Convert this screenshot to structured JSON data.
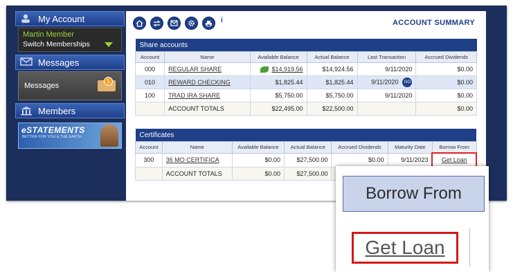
{
  "sidebar": {
    "my_account": "My Account",
    "member_name": "Martin Member",
    "switch_memberships": "Switch Memberships",
    "messages_header": "Messages",
    "messages_label": "Messages",
    "messages_badge": "1",
    "members_header": "Members",
    "estatements_title": "eSTATEMENTS",
    "estatements_tagline": "BETTER FOR YOU & THE EARTH"
  },
  "toolbar": {
    "icons": [
      "home-icon",
      "transfer-icon",
      "mail-icon",
      "settings-icon",
      "print-icon"
    ],
    "info": "i",
    "title": "ACCOUNT SUMMARY"
  },
  "shares": {
    "section_title": "Share accounts",
    "headers": [
      "Account",
      "Name",
      "Available Balance",
      "Actual Balance",
      "Last Transaction",
      "Accrued Dividends"
    ],
    "rows": [
      {
        "account": "000",
        "name": "REGULAR SHARE",
        "available": "$14,919.56",
        "actual": "$14,924.56",
        "last": "9/11/2020",
        "dividends": "$0.00"
      },
      {
        "account": "010",
        "name": "REWARD CHECKING",
        "available": "$1,825.44",
        "actual": "$1,825.44",
        "last": "9/11/2020",
        "dividends": "$0.00"
      },
      {
        "account": "100",
        "name": "TRAD IRA SHARE",
        "available": "$5,750.00",
        "actual": "$5,750.00",
        "last": "9/11/2020",
        "dividends": "$0.00"
      }
    ],
    "totals": {
      "label": "ACCOUNT TOTALS",
      "available": "$22,495.00",
      "actual": "$22,500.00",
      "dividends": "$0.00"
    },
    "go_label": "GO"
  },
  "certificates": {
    "section_title": "Certificates",
    "headers": [
      "Account",
      "Name",
      "Available Balance",
      "Actual Balance",
      "Accrued Dividends",
      "Maturity Date",
      "Borrow From"
    ],
    "rows": [
      {
        "account": "300",
        "name": "36 MO CERTIFICA",
        "available": "$0.00",
        "actual": "$27,500.00",
        "dividends": "$0.00",
        "maturity": "9/11/2023",
        "borrow": "Get Loan"
      }
    ],
    "totals": {
      "label": "ACCOUNT TOTALS",
      "available": "$0.00",
      "actual": "$27,500.00"
    }
  },
  "zoom": {
    "header": "Borrow From",
    "link": "Get Loan"
  }
}
